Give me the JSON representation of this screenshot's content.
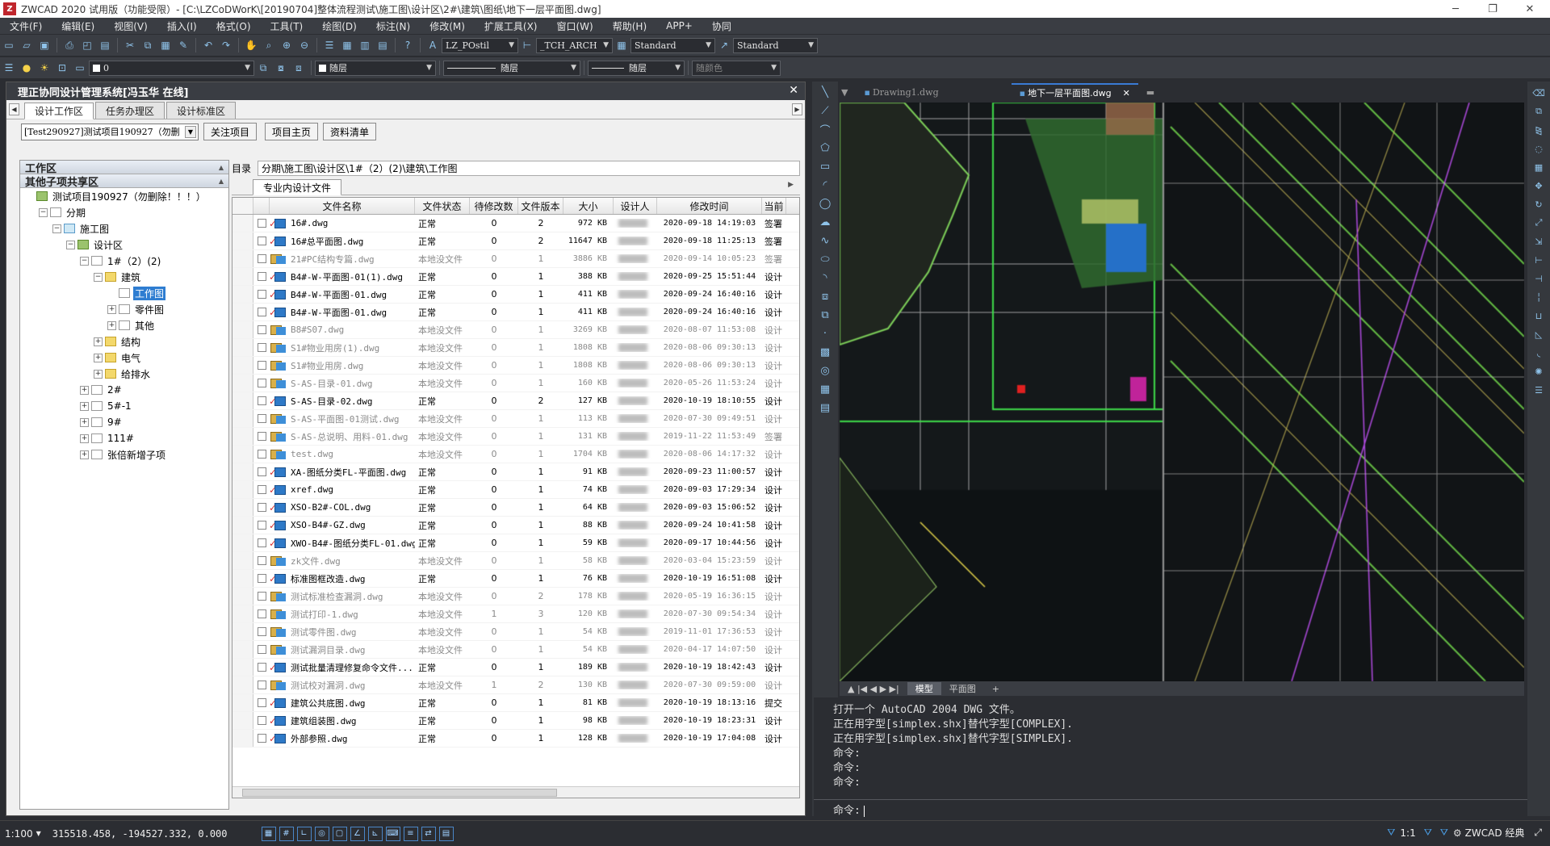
{
  "titlebar": {
    "title": "ZWCAD 2020 试用版（功能受限）- [C:\\LZCoDWorK\\[20190704]整体流程测试\\施工图\\设计区\\2#\\建筑\\图纸\\地下一层平面图.dwg]"
  },
  "menu": [
    "文件(F)",
    "编辑(E)",
    "视图(V)",
    "插入(I)",
    "格式(O)",
    "工具(T)",
    "绘图(D)",
    "标注(N)",
    "修改(M)",
    "扩展工具(X)",
    "窗口(W)",
    "帮助(H)",
    "APP+",
    "协同"
  ],
  "toolbar": {
    "textstyle": "LZ_POstil",
    "dimstyle": "_TCH_ARCH",
    "tablestyle": "Standard",
    "mleaderstyle": "Standard",
    "layer": "0",
    "color": "随层",
    "linetype": "随层",
    "lineweight": "随层",
    "plotstyle": "随颜色"
  },
  "panel": {
    "title": "理正协同设计管理系统[冯玉华 在线]",
    "tabs": [
      "设计工作区",
      "任务办理区",
      "设计标准区"
    ],
    "project_select": "[Test290927]测试项目190927（勿删",
    "buttons": {
      "follow": "关注项目",
      "home": "项目主页",
      "list": "资料清单"
    },
    "tree_header_work": "工作区",
    "tree_header_shared": "其他子项共享区",
    "tree": [
      {
        "label": "测试项目190927（勿删除！！！）",
        "indent": 0,
        "exp": "",
        "icon": "proj"
      },
      {
        "label": "分期",
        "indent": 1,
        "exp": "−",
        "icon": "doc"
      },
      {
        "label": "施工图",
        "indent": 2,
        "exp": "−",
        "icon": "grp"
      },
      {
        "label": "设计区",
        "indent": 3,
        "exp": "−",
        "icon": "proj"
      },
      {
        "label": "1#（2）(2)",
        "indent": 4,
        "exp": "−",
        "icon": "doc"
      },
      {
        "label": "建筑",
        "indent": 5,
        "exp": "−",
        "icon": "folder"
      },
      {
        "label": "工作图",
        "indent": 6,
        "exp": "",
        "icon": "doc",
        "selected": true
      },
      {
        "label": "零件图",
        "indent": 6,
        "exp": "+",
        "icon": "doc"
      },
      {
        "label": "其他",
        "indent": 6,
        "exp": "+",
        "icon": "doc"
      },
      {
        "label": "结构",
        "indent": 5,
        "exp": "+",
        "icon": "folder"
      },
      {
        "label": "电气",
        "indent": 5,
        "exp": "+",
        "icon": "folder"
      },
      {
        "label": "给排水",
        "indent": 5,
        "exp": "+",
        "icon": "folder"
      },
      {
        "label": "2#",
        "indent": 4,
        "exp": "+",
        "icon": "doc"
      },
      {
        "label": "5#-1",
        "indent": 4,
        "exp": "+",
        "icon": "doc"
      },
      {
        "label": "9#",
        "indent": 4,
        "exp": "+",
        "icon": "doc"
      },
      {
        "label": "111#",
        "indent": 4,
        "exp": "+",
        "icon": "doc"
      },
      {
        "label": "张倍新增子项",
        "indent": 4,
        "exp": "+",
        "icon": "doc"
      }
    ],
    "dir_label": "目录",
    "path": "分期\\施工图\\设计区\\1#（2）(2)\\建筑\\工作图",
    "subtab": "专业内设计文件",
    "columns": [
      "文件名称",
      "文件状态",
      "待修改数",
      "文件版本",
      "大小",
      "设计人",
      "修改时间",
      "当前"
    ],
    "files": [
      {
        "name": "16#.dwg",
        "status": "正常",
        "pending": "0",
        "ver": "2",
        "size": "972 KB",
        "time": "2020-09-18 14:19:03",
        "cur": "签署",
        "local": false
      },
      {
        "name": "16#总平面图.dwg",
        "status": "正常",
        "pending": "0",
        "ver": "2",
        "size": "11647 KB",
        "time": "2020-09-18 11:25:13",
        "cur": "签署",
        "local": false
      },
      {
        "name": "21#PC结构专篇.dwg",
        "status": "本地没文件",
        "pending": "0",
        "ver": "1",
        "size": "3886 KB",
        "time": "2020-09-14 10:05:23",
        "cur": "签署",
        "local": true
      },
      {
        "name": "B4#-W-平面图-01(1).dwg",
        "status": "正常",
        "pending": "0",
        "ver": "1",
        "size": "388 KB",
        "time": "2020-09-25 15:51:44",
        "cur": "设计",
        "local": false
      },
      {
        "name": "B4#-W-平面图-01.dwg",
        "status": "正常",
        "pending": "0",
        "ver": "1",
        "size": "411 KB",
        "time": "2020-09-24 16:40:16",
        "cur": "设计",
        "local": false
      },
      {
        "name": "B4#-W-平面图-01.dwg",
        "status": "正常",
        "pending": "0",
        "ver": "1",
        "size": "411 KB",
        "time": "2020-09-24 16:40:16",
        "cur": "设计",
        "local": false
      },
      {
        "name": "B8#S07.dwg",
        "status": "本地没文件",
        "pending": "0",
        "ver": "1",
        "size": "3269 KB",
        "time": "2020-08-07 11:53:08",
        "cur": "设计",
        "local": true
      },
      {
        "name": "S1#物业用房(1).dwg",
        "status": "本地没文件",
        "pending": "0",
        "ver": "1",
        "size": "1808 KB",
        "time": "2020-08-06 09:30:13",
        "cur": "设计",
        "local": true
      },
      {
        "name": "S1#物业用房.dwg",
        "status": "本地没文件",
        "pending": "0",
        "ver": "1",
        "size": "1808 KB",
        "time": "2020-08-06 09:30:13",
        "cur": "设计",
        "local": true
      },
      {
        "name": "S-AS-目录-01.dwg",
        "status": "本地没文件",
        "pending": "0",
        "ver": "1",
        "size": "160 KB",
        "time": "2020-05-26 11:53:24",
        "cur": "设计",
        "local": true
      },
      {
        "name": "S-AS-目录-02.dwg",
        "status": "正常",
        "pending": "0",
        "ver": "2",
        "size": "127 KB",
        "time": "2020-10-19 18:10:55",
        "cur": "设计",
        "local": false
      },
      {
        "name": "S-AS-平面图-01测试.dwg",
        "status": "本地没文件",
        "pending": "0",
        "ver": "1",
        "size": "113 KB",
        "time": "2020-07-30 09:49:51",
        "cur": "设计",
        "local": true
      },
      {
        "name": "S-AS-总说明、用料-01.dwg",
        "status": "本地没文件",
        "pending": "0",
        "ver": "1",
        "size": "131 KB",
        "time": "2019-11-22 11:53:49",
        "cur": "签署",
        "local": true
      },
      {
        "name": "test.dwg",
        "status": "本地没文件",
        "pending": "0",
        "ver": "1",
        "size": "1704 KB",
        "time": "2020-08-06 14:17:32",
        "cur": "设计",
        "local": true
      },
      {
        "name": "XA-图纸分类FL-平面图.dwg",
        "status": "正常",
        "pending": "0",
        "ver": "1",
        "size": "91 KB",
        "time": "2020-09-23 11:00:57",
        "cur": "设计",
        "local": false
      },
      {
        "name": "xref.dwg",
        "status": "正常",
        "pending": "0",
        "ver": "1",
        "size": "74 KB",
        "time": "2020-09-03 17:29:34",
        "cur": "设计",
        "local": false
      },
      {
        "name": "XSO-B2#-COL.dwg",
        "status": "正常",
        "pending": "0",
        "ver": "1",
        "size": "64 KB",
        "time": "2020-09-03 15:06:52",
        "cur": "设计",
        "local": false
      },
      {
        "name": "XSO-B4#-GZ.dwg",
        "status": "正常",
        "pending": "0",
        "ver": "1",
        "size": "88 KB",
        "time": "2020-09-24 10:41:58",
        "cur": "设计",
        "local": false
      },
      {
        "name": "XWO-B4#-图纸分类FL-01.dwg",
        "status": "正常",
        "pending": "0",
        "ver": "1",
        "size": "59 KB",
        "time": "2020-09-17 10:44:56",
        "cur": "设计",
        "local": false
      },
      {
        "name": "zk文件.dwg",
        "status": "本地没文件",
        "pending": "0",
        "ver": "1",
        "size": "58 KB",
        "time": "2020-03-04 15:23:59",
        "cur": "设计",
        "local": true
      },
      {
        "name": "标准图框改造.dwg",
        "status": "正常",
        "pending": "0",
        "ver": "1",
        "size": "76 KB",
        "time": "2020-10-19 16:51:08",
        "cur": "设计",
        "local": false
      },
      {
        "name": "测试标准检查漏洞.dwg",
        "status": "本地没文件",
        "pending": "0",
        "ver": "2",
        "size": "178 KB",
        "time": "2020-05-19 16:36:15",
        "cur": "设计",
        "local": true
      },
      {
        "name": "测试打印-1.dwg",
        "status": "本地没文件",
        "pending": "1",
        "ver": "3",
        "size": "120 KB",
        "time": "2020-07-30 09:54:34",
        "cur": "设计",
        "local": true
      },
      {
        "name": "测试零件图.dwg",
        "status": "本地没文件",
        "pending": "0",
        "ver": "1",
        "size": "54 KB",
        "time": "2019-11-01 17:36:53",
        "cur": "设计",
        "local": true
      },
      {
        "name": "测试漏洞目录.dwg",
        "status": "本地没文件",
        "pending": "0",
        "ver": "1",
        "size": "54 KB",
        "time": "2020-04-17 14:07:50",
        "cur": "设计",
        "local": true
      },
      {
        "name": "测试批量清理修复命令文件...",
        "status": "正常",
        "pending": "0",
        "ver": "1",
        "size": "189 KB",
        "time": "2020-10-19 18:42:43",
        "cur": "设计",
        "local": false
      },
      {
        "name": "测试校对漏洞.dwg",
        "status": "本地没文件",
        "pending": "1",
        "ver": "2",
        "size": "130 KB",
        "time": "2020-07-30 09:59:00",
        "cur": "设计",
        "local": true
      },
      {
        "name": "建筑公共底图.dwg",
        "status": "正常",
        "pending": "0",
        "ver": "1",
        "size": "81 KB",
        "time": "2020-10-19 18:13:16",
        "cur": "提交",
        "local": false
      },
      {
        "name": "建筑组装图.dwg",
        "status": "正常",
        "pending": "0",
        "ver": "1",
        "size": "98 KB",
        "time": "2020-10-19 18:23:31",
        "cur": "设计",
        "local": false
      },
      {
        "name": "外部参照.dwg",
        "status": "正常",
        "pending": "0",
        "ver": "1",
        "size": "128 KB",
        "time": "2020-10-19 17:04:08",
        "cur": "设计",
        "local": false
      }
    ]
  },
  "cad": {
    "doc_tabs": [
      "Drawing1.dwg",
      "地下一层平面图.dwg"
    ],
    "layout_tabs": [
      "模型",
      "平面图",
      "+"
    ],
    "command_history": [
      "打开一个 AutoCAD 2004 DWG 文件。",
      "正在用字型[simplex.shx]替代字型[COMPLEX].",
      "正在用字型[simplex.shx]替代字型[SIMPLEX].",
      "命令:",
      "命令:",
      "命令:"
    ],
    "prompt": "命令:"
  },
  "status": {
    "scale": "1:100",
    "coords": "315518.458, -194527.332, 0.000",
    "anno_scale": "1:1",
    "workspace": "ZWCAD 经典"
  }
}
